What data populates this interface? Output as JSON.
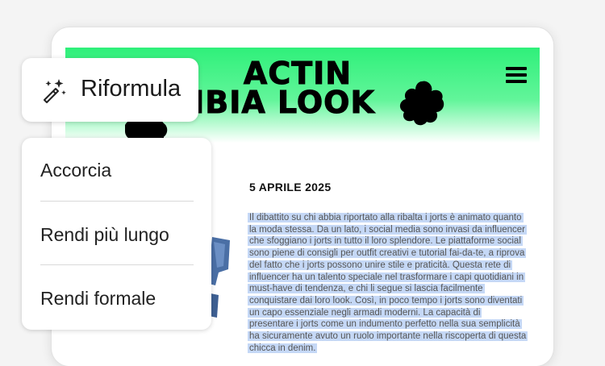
{
  "hero": {
    "line1": "ACTIN",
    "line2": "AMBIA LOOK"
  },
  "article": {
    "date": "5 APRILE 2025",
    "body": "Il dibattito su chi abbia riportato alla ribalta i jorts è animato quanto la moda stessa. Da un lato, i social media sono invasi da influencer che sfoggiano i jorts in tutto il loro splendore. Le piattaforme social sono piene di consigli per outfit creativi e tutorial fai-da-te, a riprova del fatto che i jorts possono unire stile e praticità. Questa rete di influencer ha un talento speciale nel trasformare i capi quotidiani in must-have di tendenza, e chi li segue si lascia facilmente conquistare dai loro look. Così, in poco tempo i jorts sono diventati un capo essenziale negli armadi moderni. La capacità di presentare i jorts come un indumento perfetto nella sua semplicità ha sicuramente avuto un ruolo importante nella riscoperta di questa chicca in denim."
  },
  "rephrase_menu": {
    "button_label": "Riformula",
    "icon": "magic-wand-icon",
    "options": [
      "Accorcia",
      "Rendi più lungo",
      "Rendi formale"
    ]
  },
  "colors": {
    "hero_green": "#2ff07a",
    "selection": "#c5d8f6"
  }
}
